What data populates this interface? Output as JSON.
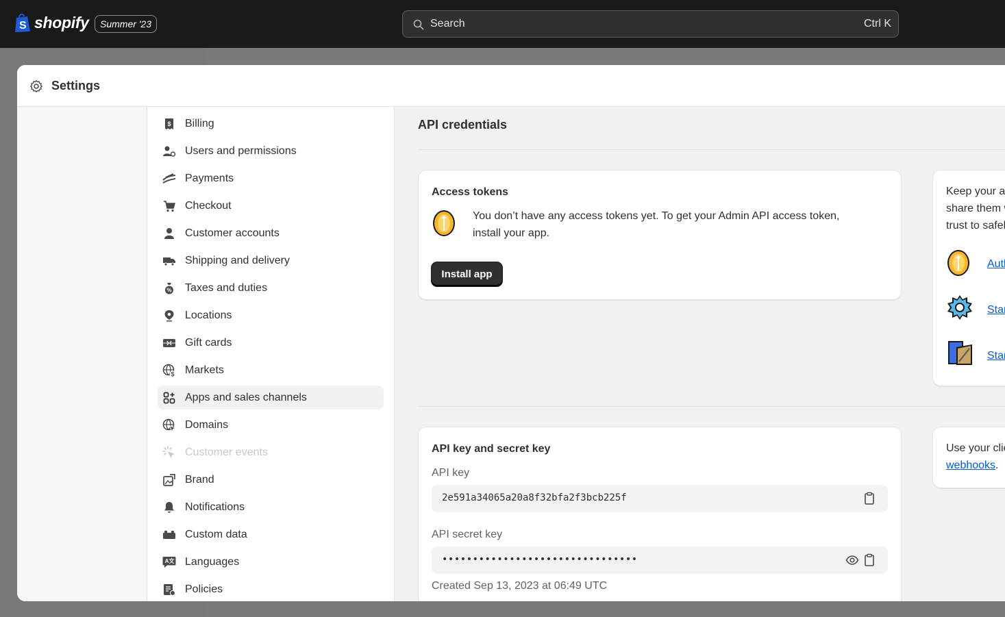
{
  "topbar": {
    "logo_text": "shopify",
    "edition_badge": "Summer '23",
    "search_placeholder": "Search",
    "search_shortcut": "Ctrl K"
  },
  "modal": {
    "title": "Settings"
  },
  "nav": {
    "items": [
      {
        "label": "Billing",
        "icon": "receipt-icon"
      },
      {
        "label": "Users and permissions",
        "icon": "users-icon"
      },
      {
        "label": "Payments",
        "icon": "payments-icon"
      },
      {
        "label": "Checkout",
        "icon": "cart-icon"
      },
      {
        "label": "Customer accounts",
        "icon": "person-icon"
      },
      {
        "label": "Shipping and delivery",
        "icon": "truck-icon"
      },
      {
        "label": "Taxes and duties",
        "icon": "tax-bag-icon"
      },
      {
        "label": "Locations",
        "icon": "location-pin-icon"
      },
      {
        "label": "Gift cards",
        "icon": "gift-card-icon"
      },
      {
        "label": "Markets",
        "icon": "globe-dollar-icon"
      },
      {
        "label": "Apps and sales channels",
        "icon": "apps-icon",
        "active": true
      },
      {
        "label": "Domains",
        "icon": "globe-cursor-icon"
      },
      {
        "label": "Customer events",
        "icon": "cursor-click-icon",
        "disabled": true
      },
      {
        "label": "Brand",
        "icon": "brand-icon"
      },
      {
        "label": "Notifications",
        "icon": "bell-icon"
      },
      {
        "label": "Custom data",
        "icon": "custom-data-icon"
      },
      {
        "label": "Languages",
        "icon": "language-icon"
      },
      {
        "label": "Policies",
        "icon": "policy-icon"
      }
    ]
  },
  "content": {
    "section_title": "API credentials",
    "access_tokens": {
      "title": "Access tokens",
      "message_line1": "You don’t have any access tokens yet. To get your Admin API access token,",
      "message_line2": "install your app.",
      "install_button": "Install app"
    },
    "side_card": {
      "line1": "Keep your acc",
      "line2": "share them wit",
      "line3": "trust to safely",
      "link1": "Auther",
      "link2": "Start u",
      "link3": "Start u"
    },
    "api_keys": {
      "title": "API key and secret key",
      "api_key_label": "API key",
      "api_key_value": "2e591a34065a20a8f32bfa2f3bcb225f",
      "secret_key_label": "API secret key",
      "secret_key_value": "••••••••••••••••••••••••••••••••",
      "created_text": "Created Sep 13, 2023 at 06:49 UTC"
    },
    "side_card2": {
      "line1": "Use your client",
      "link": "webhooks",
      "suffix": "."
    }
  },
  "colors": {
    "topbar_bg": "#1a1a1a",
    "link": "#005bd3",
    "button_dark": "#303030",
    "content_bg": "#f1f1f1"
  }
}
